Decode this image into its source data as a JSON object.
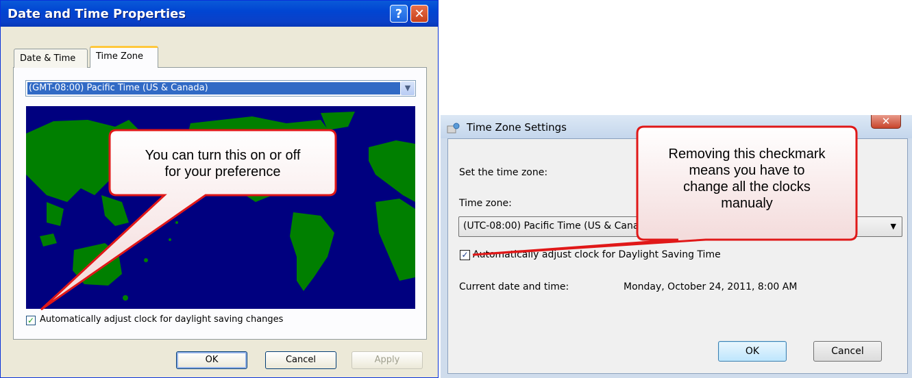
{
  "xp_dialog": {
    "title": "Date and Time Properties",
    "help_glyph": "?",
    "close_glyph": "✕",
    "tabs": [
      {
        "label": "Date & Time",
        "selected": false
      },
      {
        "label": "Time Zone",
        "selected": true
      }
    ],
    "timezone_select": {
      "value": "(GMT-08:00) Pacific Time (US & Canada)",
      "arrow_glyph": "▼"
    },
    "map": {
      "ocean_color": "#00007f",
      "land_color": "#007f00"
    },
    "dst_checkbox": {
      "checked": true,
      "check_glyph": "✓",
      "label": "Automatically adjust clock for daylight saving changes"
    },
    "buttons": {
      "ok": "OK",
      "cancel": "Cancel",
      "apply": "Apply"
    }
  },
  "w7_dialog": {
    "title": "Time Zone Settings",
    "close_glyph": "✕",
    "icon": "globe-clock-icon",
    "set_label": "Set the time zone:",
    "timezone_label": "Time zone:",
    "timezone_select": {
      "value": "(UTC-08:00) Pacific Time (US & Canada)",
      "arrow_glyph": "▼"
    },
    "dst_checkbox": {
      "checked": true,
      "check_glyph": "✓",
      "label": "Automatically adjust clock for Daylight Saving Time"
    },
    "current_label": "Current date and time:",
    "current_value": "Monday, October 24, 2011, 8:00 AM",
    "buttons": {
      "ok": "OK",
      "cancel": "Cancel"
    }
  },
  "callouts": {
    "left": [
      "You can turn this on or off",
      "for your preference"
    ],
    "right": [
      "Removing this checkmark",
      "means you have to",
      "change all the clocks",
      "manualy"
    ],
    "fill_color": "#ffffff",
    "border_color": "#e01818"
  }
}
